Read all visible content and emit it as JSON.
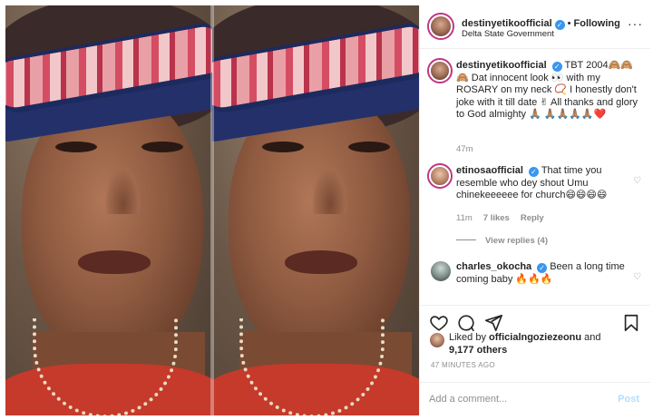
{
  "post": {
    "author": "destinyetikoofficial",
    "follow_label": "Following",
    "location": "Delta State Government",
    "caption": "TBT 2004🙈🙈🙈 Dat innocent look 👀 with my ROSARY on my neck 📿 I honestly don't joke with it till date ✌ All thanks and glory to God almighty 🙏🏽 🙏🏽🙏🏽🙏🏽🙏🏽❤️",
    "caption_time": "47m"
  },
  "comments": [
    {
      "user": "etinosaofficial",
      "text": "That time you resemble who dey shout Umu chinekeeeeee for church😄😄😄😄",
      "time": "11m",
      "likes": "7 likes",
      "reply": "Reply",
      "view_replies": "View replies (4)"
    },
    {
      "user": "charles_okocha",
      "text": "Been a long time coming baby 🔥🔥🔥",
      "time": "",
      "likes": "",
      "reply": ""
    }
  ],
  "likes": {
    "prefix": "Liked by",
    "user": "officialngoziezeonu",
    "suffix": "and",
    "others": "9,177 others"
  },
  "timestamp": "47 MINUTES AGO",
  "add_comment": {
    "placeholder": "Add a comment...",
    "post_label": "Post"
  },
  "icons": {
    "verified": "verified-check-icon",
    "more": "more-options-icon",
    "like": "heart-icon",
    "comment": "comment-bubble-icon",
    "share": "paper-plane-icon",
    "save": "bookmark-icon"
  },
  "colors": {
    "verified": "#3897f0",
    "story_ring": "#c13584",
    "muted": "#8e8e8e",
    "post_disabled": "#b2dffc"
  }
}
